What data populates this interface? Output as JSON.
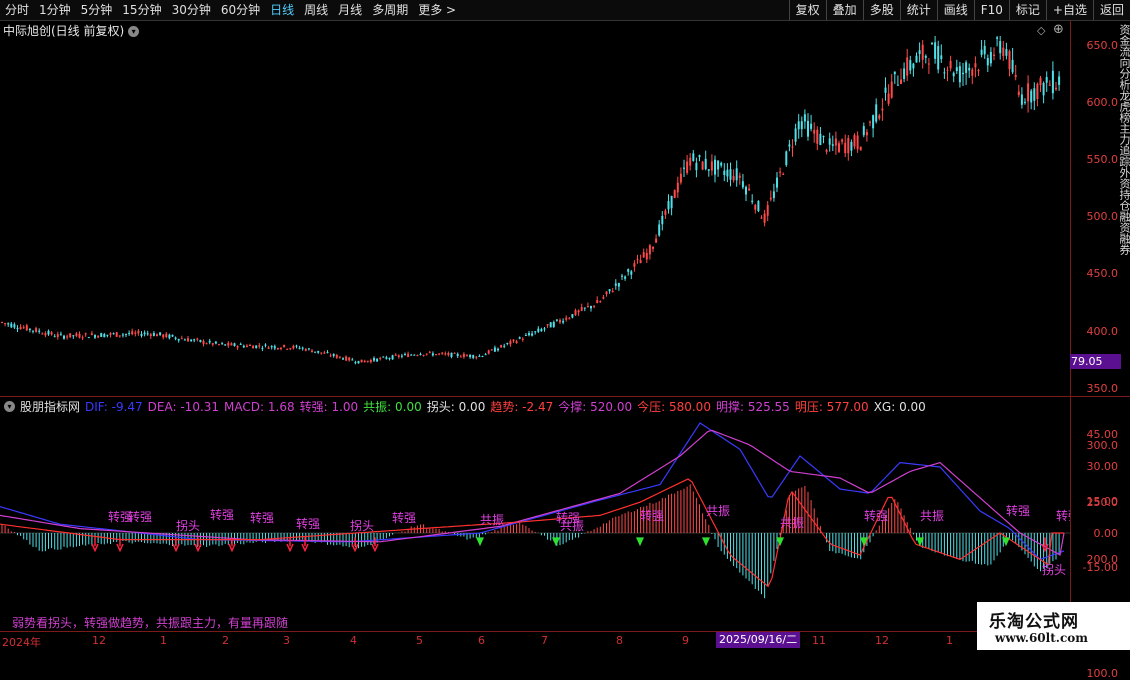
{
  "toolbar": {
    "periods": [
      "分时",
      "1分钟",
      "5分钟",
      "15分钟",
      "30分钟",
      "60分钟",
      "日线",
      "周线",
      "月线",
      "多周期",
      "更多 >"
    ],
    "active_period": "日线",
    "tools": [
      "复权",
      "叠加",
      "多股",
      "统计",
      "画线",
      "F10",
      "标记",
      "+自选",
      "返回"
    ]
  },
  "stock": {
    "title": "中际旭创(日线 前复权)"
  },
  "price_axis": {
    "ticks": [
      "650.0",
      "600.0",
      "550.0",
      "500.0",
      "450.0",
      "400.0",
      "350.0",
      "300.0",
      "250.0",
      "200.0",
      "150.0",
      "100.0"
    ],
    "current_tag": "79.05"
  },
  "indicator": {
    "name": "股朋指标网",
    "values": [
      {
        "label": "DIF: -9.47",
        "color": "#3a3aff"
      },
      {
        "label": "DEA: -10.31",
        "color": "#d040d0"
      },
      {
        "label": "MACD: 1.68",
        "color": "#d040d0"
      },
      {
        "label": "转强: 1.00",
        "color": "#d040d0"
      },
      {
        "label": "共振: 0.00",
        "color": "#40e040"
      },
      {
        "label": "拐头: 0.00",
        "color": "#e0e0e0"
      },
      {
        "label": "趋势: -2.47",
        "color": "#ff4040"
      },
      {
        "label": "今撑: 520.00",
        "color": "#d040d0"
      },
      {
        "label": "今压: 580.00",
        "color": "#ff4040"
      },
      {
        "label": "明撑: 525.55",
        "color": "#d040d0"
      },
      {
        "label": "明压: 577.00",
        "color": "#ff4040"
      },
      {
        "label": "XG: 0.00",
        "color": "#e0e0e0"
      }
    ],
    "yticks": [
      "45.00",
      "30.00",
      "15.00",
      "0.00",
      "-15.00"
    ],
    "signal_labels": [
      "转强",
      "转强",
      "拐头",
      "转强",
      "转强",
      "转强",
      "拐头",
      "转强",
      "共振",
      "转强",
      "共振",
      "转强",
      "共振",
      "共振",
      "转强",
      "共振",
      "转强",
      "转强",
      "拐头"
    ]
  },
  "slogan": "弱势看拐头，转强做趋势，共振跟主力，有量再跟随",
  "date_axis": {
    "labels": [
      "2024年",
      "12",
      "1",
      "2",
      "3",
      "4",
      "5",
      "6",
      "7",
      "8",
      "9",
      "11",
      "12",
      "1"
    ],
    "selected": "2025/09/16/二"
  },
  "brand": {
    "name": "乐淘公式网",
    "url": "www.60lt.com"
  },
  "right_side": "资金流向分析龙虎榜主力追踪外资持仓融资融券"
}
